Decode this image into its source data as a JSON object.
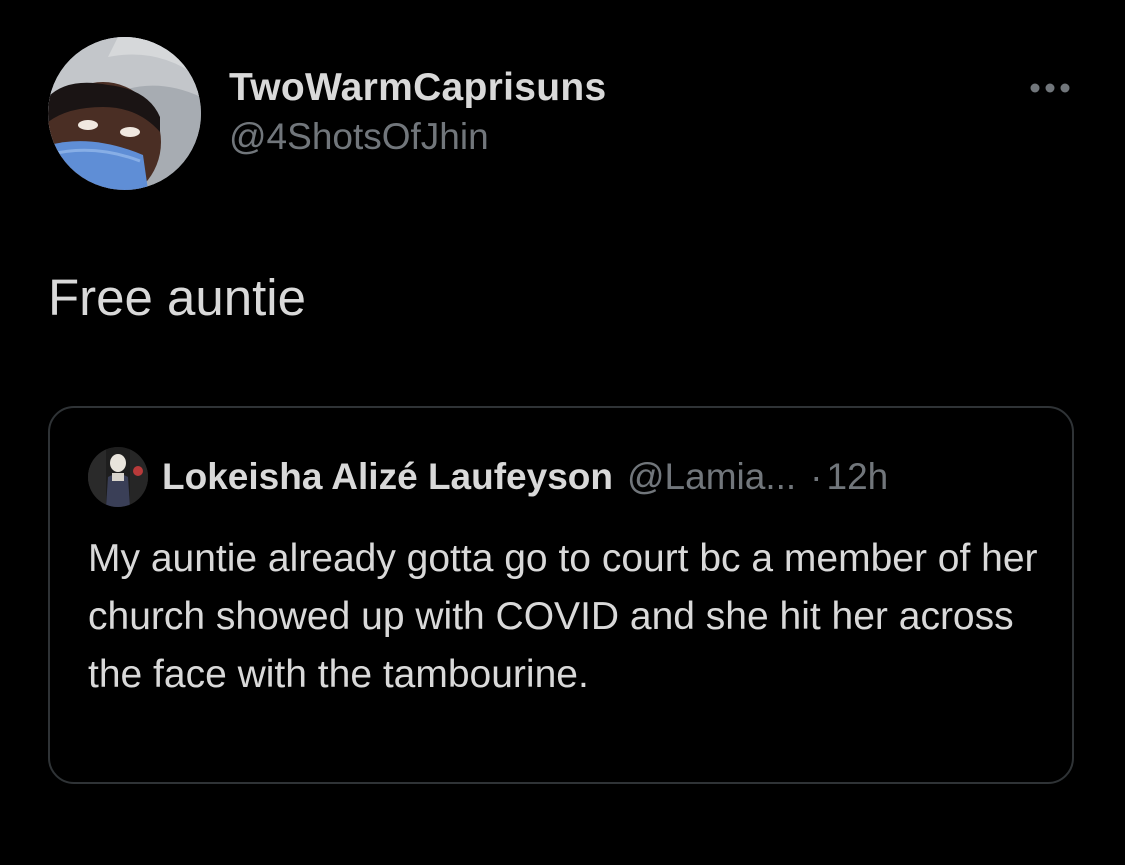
{
  "tweet": {
    "author": {
      "display_name": "TwoWarmCaprisuns",
      "handle": "@4ShotsOfJhin",
      "avatar_icon": "profile-photo"
    },
    "more_icon": "more-horizontal-icon",
    "text": "Free auntie"
  },
  "quoted_tweet": {
    "author": {
      "display_name": "Lokeisha Alizé Laufeyson",
      "handle": "@Lamia...",
      "avatar_icon": "profile-photo"
    },
    "separator": "·",
    "time": "12h",
    "text": "My auntie already gotta go to court bc a member of her church showed up with COVID and she hit her across the face with the tambourine."
  },
  "colors": {
    "background": "#000000",
    "primary_text": "#d9d9d9",
    "secondary_text": "#71767b",
    "border": "#2f3336"
  }
}
